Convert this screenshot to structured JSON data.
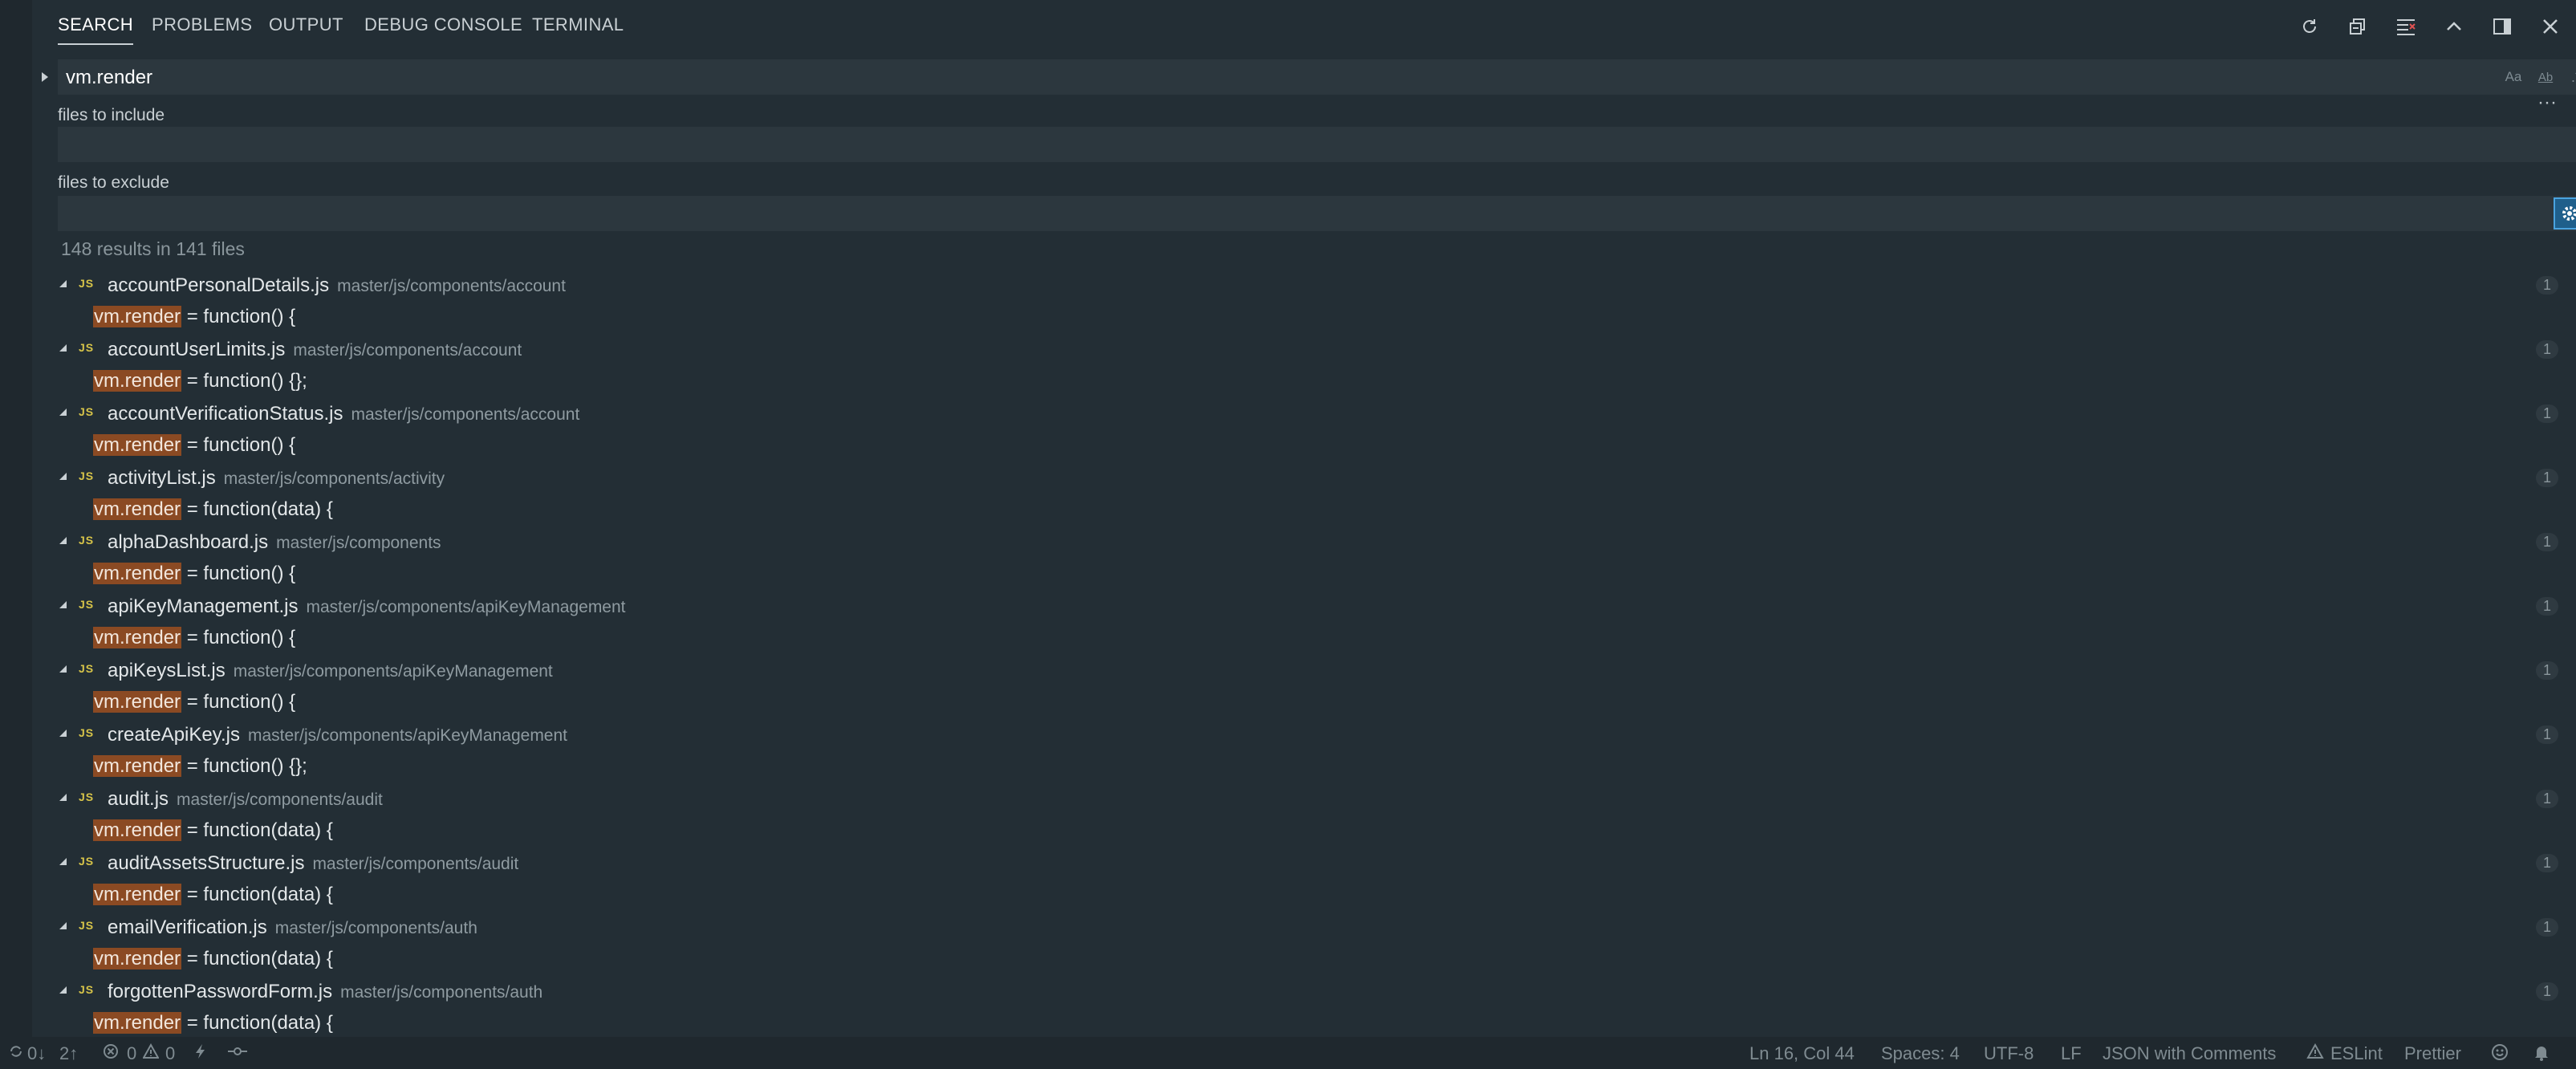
{
  "tabs": [
    {
      "label": "SEARCH",
      "active": true
    },
    {
      "label": "PROBLEMS",
      "active": false
    },
    {
      "label": "OUTPUT",
      "active": false
    },
    {
      "label": "DEBUG CONSOLE",
      "active": false
    },
    {
      "label": "TERMINAL",
      "active": false
    }
  ],
  "toolbar_icons": [
    "refresh-icon",
    "collapse-all-icon",
    "clear-results-icon",
    "chevron-up-icon",
    "toggle-panel-layout-icon",
    "close-icon"
  ],
  "search": {
    "query": "vm.render",
    "options": {
      "match_case": "Aa",
      "whole_word": "Ab",
      "regex": ".*"
    },
    "more_label": "···",
    "include_label": "files to include",
    "include_value": "",
    "exclude_label": "files to exclude",
    "exclude_value": "",
    "summary": "148 results in 141 files"
  },
  "results": [
    {
      "file": "accountPersonalDetails.js",
      "path": "master/js/components/account",
      "count": "1",
      "hl": "vm.render",
      "rest": " = function() {"
    },
    {
      "file": "accountUserLimits.js",
      "path": "master/js/components/account",
      "count": "1",
      "hl": "vm.render",
      "rest": " = function() {};"
    },
    {
      "file": "accountVerificationStatus.js",
      "path": "master/js/components/account",
      "count": "1",
      "hl": "vm.render",
      "rest": " = function() {"
    },
    {
      "file": "activityList.js",
      "path": "master/js/components/activity",
      "count": "1",
      "hl": "vm.render",
      "rest": " = function(data) {"
    },
    {
      "file": "alphaDashboard.js",
      "path": "master/js/components",
      "count": "1",
      "hl": "vm.render",
      "rest": " = function() {"
    },
    {
      "file": "apiKeyManagement.js",
      "path": "master/js/components/apiKeyManagement",
      "count": "1",
      "hl": "vm.render",
      "rest": " = function() {"
    },
    {
      "file": "apiKeysList.js",
      "path": "master/js/components/apiKeyManagement",
      "count": "1",
      "hl": "vm.render",
      "rest": " = function() {"
    },
    {
      "file": "createApiKey.js",
      "path": "master/js/components/apiKeyManagement",
      "count": "1",
      "hl": "vm.render",
      "rest": " = function() {};"
    },
    {
      "file": "audit.js",
      "path": "master/js/components/audit",
      "count": "1",
      "hl": "vm.render",
      "rest": " = function(data) {"
    },
    {
      "file": "auditAssetsStructure.js",
      "path": "master/js/components/audit",
      "count": "1",
      "hl": "vm.render",
      "rest": " = function(data) {"
    },
    {
      "file": "emailVerification.js",
      "path": "master/js/components/auth",
      "count": "1",
      "hl": "vm.render",
      "rest": " = function(data) {"
    },
    {
      "file": "forgottenPasswordForm.js",
      "path": "master/js/components/auth",
      "count": "1",
      "hl": "vm.render",
      "rest": " = function(data) {"
    }
  ],
  "status": {
    "sync_down": "0↓",
    "sync_up": "2↑",
    "errors": "0",
    "warnings": "0",
    "position": "Ln 16, Col 44",
    "spaces": "Spaces: 4",
    "encoding": "UTF-8",
    "eol": "LF",
    "language": "JSON with Comments",
    "eslint": "ESLint",
    "prettier": "Prettier"
  }
}
